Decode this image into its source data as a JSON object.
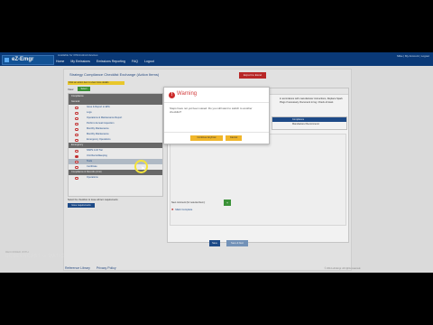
{
  "app": {
    "logo_text": "eZ-Emgr",
    "tagline": "Available for iOS/Android devices",
    "nav": [
      "Home",
      "My Emissions",
      "Emissions Reporting",
      "FAQ",
      "Logout"
    ],
    "user_area": "Mike | My Account | Logout"
  },
  "page": {
    "title": "Strategy Compliance Checklist Exchange (Action Items)",
    "red_button": "Export to Excel",
    "instruction": "Click an action item to view more details",
    "view_label": "View",
    "green_button": "Select",
    "bottom_note": "Select the checkbox to issue all item requirements",
    "bottom_button": "Issue requirements"
  },
  "tree": {
    "rows": [
      {
        "type": "cat",
        "label": "Compliance"
      },
      {
        "type": "cat",
        "label": "General"
      },
      {
        "type": "item",
        "label": "Issue & Report to EPA",
        "dot": false
      },
      {
        "type": "item",
        "label": "Logs",
        "dot": false
      },
      {
        "type": "item",
        "label": "Operations & Maintenance Report",
        "dot": false
      },
      {
        "type": "item",
        "label": "Perform Annual Inspection",
        "dot": false
      },
      {
        "type": "item",
        "label": "Monthly Maintenance",
        "dot": false
      },
      {
        "type": "item",
        "label": "Monthly Maintenance",
        "dot": false
      },
      {
        "type": "item",
        "label": "Emergency Operations",
        "dot": false
      },
      {
        "type": "cat",
        "label": "Emergency"
      },
      {
        "type": "item",
        "label": "NSPS JJJJ Tier",
        "dot": false
      },
      {
        "type": "item",
        "label": "Unit Recordkeeping",
        "dot": true
      },
      {
        "type": "item",
        "label": "Tests",
        "dot": false,
        "highlight": true
      },
      {
        "type": "item",
        "label": "Certificate",
        "dot": false
      },
      {
        "type": "cat",
        "label": "Compliance & Records (Unit)"
      },
      {
        "type": "item",
        "label": "Operations",
        "dot": false
      }
    ]
  },
  "right": {
    "header": "Notes",
    "text": "in accordance with manufacturer instructions, Replace Spark Plugs if necessary. Document in log. Check oil level.",
    "table_header": "Compliance",
    "table_cell": "Manufacturer Recommend",
    "add_label": "New comment (for selected item):",
    "add_button": "+",
    "link": "Mark Complete",
    "save": "Save",
    "next": "Save & Next"
  },
  "modal": {
    "title": "Warning",
    "message": "Steps have not yet been saved. Do you still want to switch to another checklist?",
    "continue": "Continue Anyhow",
    "cancel": "Cancel"
  },
  "footer": {
    "links": [
      "Reference Library",
      "Privacy Policy"
    ],
    "copyright": "© 2014 eZ-Emgr. All rights reserved."
  },
  "watermark": {
    "line1": "RECORDED WITH",
    "line2": "SCREENCAST ⊙ MATIC"
  },
  "colors": {
    "topbar": "#0b3d7e",
    "accent_blue": "#1f4f8f",
    "warning_red": "#cc2b2b",
    "button_yellow": "#f0b62b",
    "green": "#3f9a3a"
  }
}
